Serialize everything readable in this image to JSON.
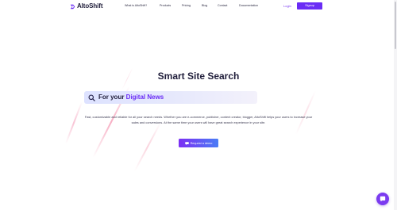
{
  "header": {
    "logo_text": "AltoShift",
    "nav": [
      "What is AltoShift?",
      "Products",
      "Pricing",
      "Blog",
      "Contact",
      "Documentation"
    ],
    "login_label": "Login",
    "signup_label": "Signup"
  },
  "hero": {
    "title": "Smart Site Search",
    "search_prefix": "For your ",
    "search_highlight": "Digital News",
    "description": "Fast, customizable and reliable for all your search needs. Whether you are e-commerce, publisher, content creator, blogger, AltoShift helps your users to increase your sales and conversions. At the same time your users will have great search experience in your site.",
    "demo_button_label": "Request a demo"
  },
  "icons": {
    "logo": "altoshift-logo-icon",
    "search": "search-icon",
    "demo": "chat-bubble-icon",
    "chat": "chat-widget-icon"
  },
  "colors": {
    "brand": "#6a2cf5",
    "login": "#7b3bf0",
    "title": "#1f1d3a"
  }
}
